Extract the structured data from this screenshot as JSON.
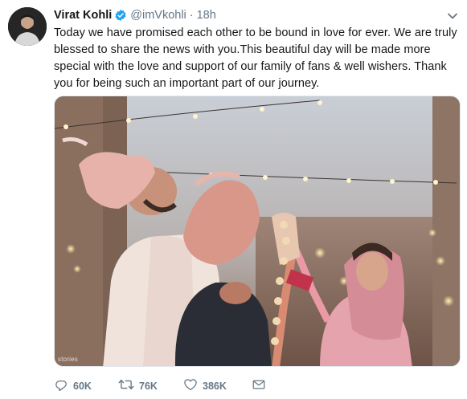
{
  "tweet": {
    "author_name": "Virat Kohli",
    "handle": "@imVkohli",
    "separator": "·",
    "time": "18h",
    "text": "Today we have promised each other to be bound in love for ever. We are truly blessed to share the news with you.This beautiful day will be made more special with the love and support of our family of fans & well wishers. Thank you for being such an important part of our journey.",
    "media_credit": "stories",
    "verified_color": "#1da1f2"
  },
  "actions": {
    "reply_count": "60K",
    "retweet_count": "76K",
    "like_count": "386K"
  },
  "icons": {
    "reply": "reply-icon",
    "retweet": "retweet-icon",
    "like": "heart-icon",
    "dm": "envelope-icon",
    "caret": "chevron-down-icon",
    "verified": "verified-badge-icon"
  }
}
